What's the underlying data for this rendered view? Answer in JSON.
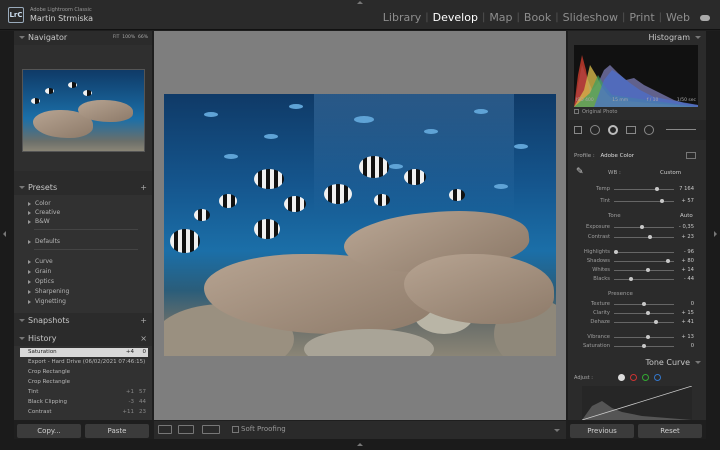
{
  "app": {
    "logo": "LrC",
    "name": "Adobe Lightroom Classic",
    "user": "Martin Strmiska"
  },
  "modules": [
    {
      "label": "Library",
      "active": false
    },
    {
      "label": "Develop",
      "active": true
    },
    {
      "label": "Map",
      "active": false
    },
    {
      "label": "Book",
      "active": false
    },
    {
      "label": "Slideshow",
      "active": false
    },
    {
      "label": "Print",
      "active": false
    },
    {
      "label": "Web",
      "active": false
    }
  ],
  "left": {
    "navigator": {
      "title": "Navigator",
      "zoom": [
        "FIT",
        "100%",
        "66%"
      ]
    },
    "presets": {
      "title": "Presets",
      "groups": [
        "Color",
        "Creative",
        "B&W",
        "Defaults",
        "Curve",
        "Grain",
        "Optics",
        "Sharpening",
        "Vignetting"
      ]
    },
    "snapshots": {
      "title": "Snapshots"
    },
    "history": {
      "title": "History",
      "items": [
        {
          "label": "Saturation",
          "a": "+4",
          "b": "0",
          "selected": true
        },
        {
          "label": "Export - Hard Drive (06/02/2021 07:46:15)",
          "a": "",
          "b": "",
          "selected": false
        },
        {
          "label": "Crop Rectangle",
          "a": "",
          "b": "",
          "selected": false
        },
        {
          "label": "Crop Rectangle",
          "a": "",
          "b": "",
          "selected": false
        },
        {
          "label": "Tint",
          "a": "+1",
          "b": "57",
          "selected": false
        },
        {
          "label": "Black Clipping",
          "a": "-3",
          "b": "44",
          "selected": false
        },
        {
          "label": "Contrast",
          "a": "+11",
          "b": "23",
          "selected": false
        }
      ]
    },
    "copy": "Copy...",
    "paste": "Paste"
  },
  "right": {
    "histogram": {
      "title": "Histogram",
      "info": [
        "ISO 400",
        "15 mm",
        "f / 10",
        "1/50 sec"
      ],
      "original": "Original Photo"
    },
    "basic": {
      "profile_label": "Profile :",
      "profile": "Adobe Color",
      "wb_label": "WB :",
      "wb": "Custom",
      "tone": "Tone",
      "auto": "Auto",
      "presence": "Presence",
      "sliders": [
        {
          "label": "Temp",
          "value": "7 164",
          "pos": 0.72
        },
        {
          "label": "Tint",
          "value": "+ 57",
          "pos": 0.8
        },
        {
          "label": "Exposure",
          "value": "- 0,35",
          "pos": 0.47
        },
        {
          "label": "Contrast",
          "value": "+ 23",
          "pos": 0.6
        },
        {
          "label": "Highlights",
          "value": "- 96",
          "pos": 0.03
        },
        {
          "label": "Shadows",
          "value": "+ 80",
          "pos": 0.9
        },
        {
          "label": "Whites",
          "value": "+ 14",
          "pos": 0.57
        },
        {
          "label": "Blacks",
          "value": "- 44",
          "pos": 0.28
        },
        {
          "label": "Texture",
          "value": "0",
          "pos": 0.5
        },
        {
          "label": "Clarity",
          "value": "+ 15",
          "pos": 0.57
        },
        {
          "label": "Dehaze",
          "value": "+ 41",
          "pos": 0.7
        },
        {
          "label": "Vibrance",
          "value": "+ 13",
          "pos": 0.56
        },
        {
          "label": "Saturation",
          "value": "0",
          "pos": 0.5
        }
      ]
    },
    "tonecurve": {
      "title": "Tone Curve",
      "adjust": "Adjust :"
    },
    "previous": "Previous",
    "reset": "Reset"
  },
  "toolbar": {
    "soft_proofing": "Soft Proofing"
  }
}
